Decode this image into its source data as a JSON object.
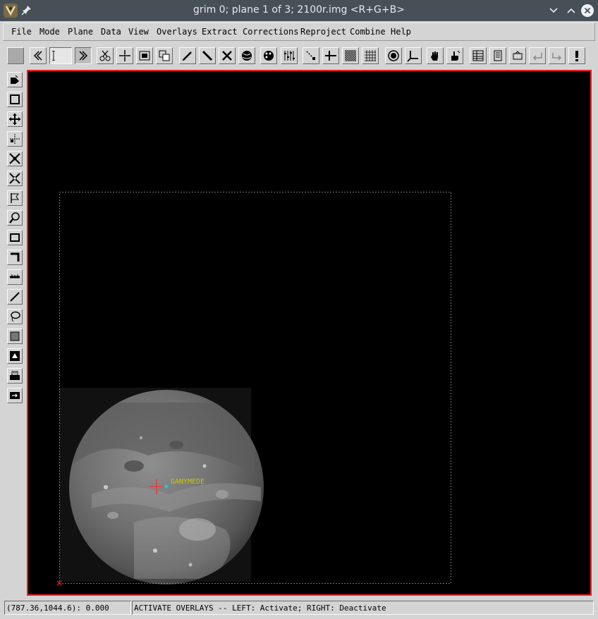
{
  "window": {
    "title": "grim 0;  plane 1 of 3;  2100r.img <R+G+B>",
    "icons": {
      "app": "grim-app-icon",
      "pin": "pin-icon",
      "minimize": "chevron-down-icon",
      "maximize": "chevron-up-icon",
      "close": "close-icon"
    }
  },
  "menu": {
    "file": "File",
    "mode": "Mode",
    "plane": "Plane",
    "data": "Data",
    "view": "View",
    "overlays": "Overlays",
    "extract": "Extract",
    "corrections": "Corrections",
    "reproject": "Reproject",
    "combine": "Combine",
    "help": "Help"
  },
  "canvas": {
    "target_label": "GANYMEDE",
    "border_color": "#ff1a1a",
    "label_color": "#c9c400",
    "crosshair_color": "#ff3030",
    "center_marker_color": "#33d6d6"
  },
  "status": {
    "coordinates": "(787.36,1044.6): 0.000",
    "message": "ACTIVATE OVERLAYS -- LEFT: Activate; RIGHT: Deactivate"
  }
}
